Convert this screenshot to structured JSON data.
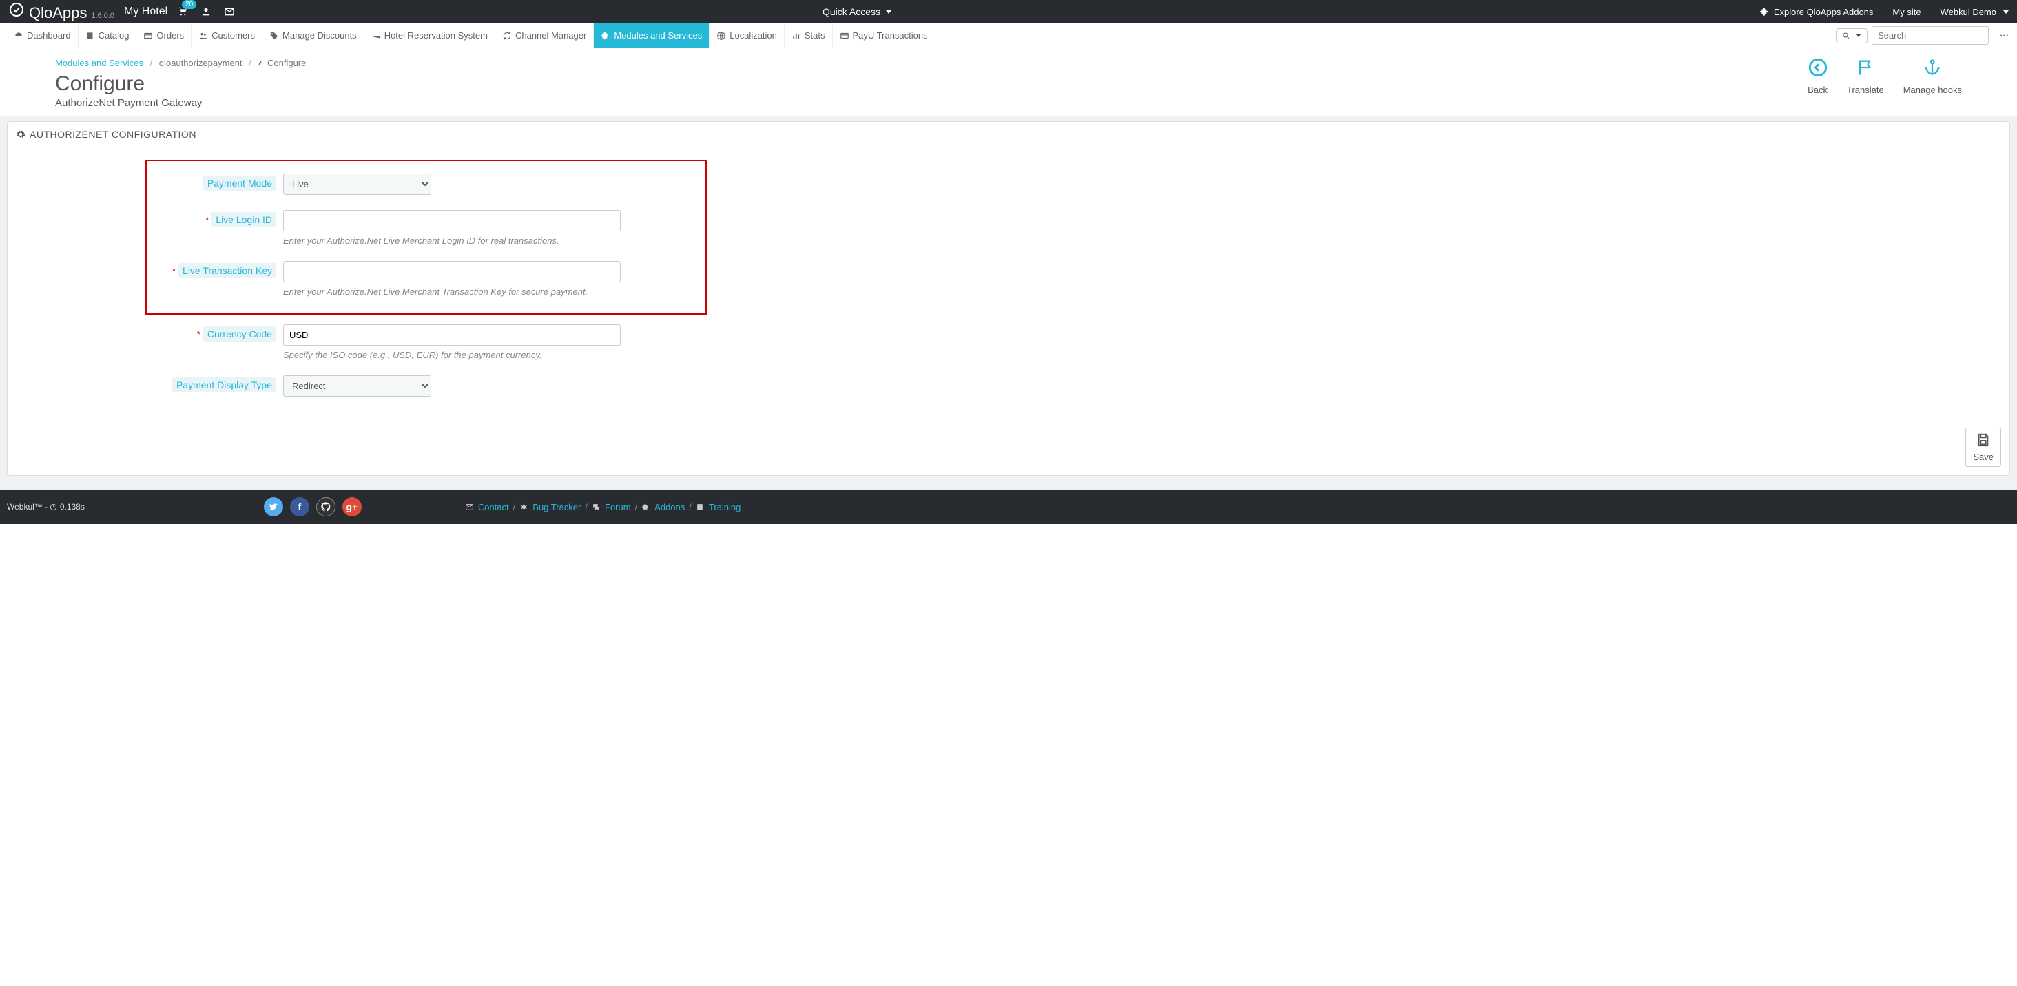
{
  "topbar": {
    "brand": "QloApps",
    "version": "1.6.0.0",
    "hotel_name": "My Hotel",
    "cart_badge": "20",
    "quick_access_label": "Quick Access",
    "explore_addons": "Explore QloApps Addons",
    "my_site": "My site",
    "user_menu": "Webkul Demo"
  },
  "nav": {
    "items": [
      "Dashboard",
      "Catalog",
      "Orders",
      "Customers",
      "Manage Discounts",
      "Hotel Reservation System",
      "Channel Manager",
      "Modules and Services",
      "Localization",
      "Stats",
      "PayU Transactions"
    ],
    "active_index": 7,
    "search_placeholder": "Search"
  },
  "breadcrumb": {
    "a": "Modules and Services",
    "b": "qloauthorizepayment",
    "c": "Configure"
  },
  "page": {
    "title": "Configure",
    "subtitle": "AuthorizeNet Payment Gateway"
  },
  "head_actions": {
    "back": "Back",
    "translate": "Translate",
    "hooks": "Manage hooks"
  },
  "panel": {
    "heading": "AUTHORIZENET CONFIGURATION"
  },
  "form": {
    "payment_mode": {
      "label": "Payment Mode",
      "value": "Live"
    },
    "live_login_id": {
      "label": "Live Login ID",
      "value": "",
      "help": "Enter your Authorize.Net Live Merchant Login ID for real transactions."
    },
    "live_trans_key": {
      "label": "Live Transaction Key",
      "value": "",
      "help": "Enter your Authorize.Net Live Merchant Transaction Key for secure payment."
    },
    "currency_code": {
      "label": "Currency Code",
      "value": "USD",
      "help": "Specify the ISO code (e.g., USD, EUR) for the payment currency."
    },
    "display_type": {
      "label": "Payment Display Type",
      "value": "Redirect"
    },
    "save": "Save"
  },
  "footer": {
    "copyright": "Webkul™ - ",
    "load_time": "0.138s",
    "links": {
      "contact": "Contact",
      "bug": "Bug Tracker",
      "forum": "Forum",
      "addons": "Addons",
      "training": "Training"
    }
  }
}
